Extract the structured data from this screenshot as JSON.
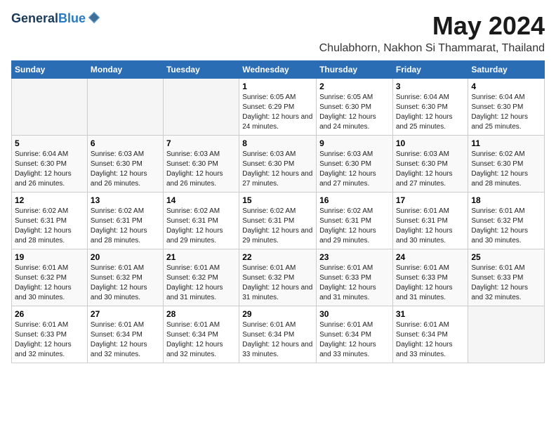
{
  "logo": {
    "general": "General",
    "blue": "Blue"
  },
  "title": {
    "month_year": "May 2024",
    "location": "Chulabhorn, Nakhon Si Thammarat, Thailand"
  },
  "weekdays": [
    "Sunday",
    "Monday",
    "Tuesday",
    "Wednesday",
    "Thursday",
    "Friday",
    "Saturday"
  ],
  "weeks": [
    [
      {
        "day": "",
        "info": ""
      },
      {
        "day": "",
        "info": ""
      },
      {
        "day": "",
        "info": ""
      },
      {
        "day": "1",
        "info": "Sunrise: 6:05 AM\nSunset: 6:29 PM\nDaylight: 12 hours and 24 minutes."
      },
      {
        "day": "2",
        "info": "Sunrise: 6:05 AM\nSunset: 6:30 PM\nDaylight: 12 hours and 24 minutes."
      },
      {
        "day": "3",
        "info": "Sunrise: 6:04 AM\nSunset: 6:30 PM\nDaylight: 12 hours and 25 minutes."
      },
      {
        "day": "4",
        "info": "Sunrise: 6:04 AM\nSunset: 6:30 PM\nDaylight: 12 hours and 25 minutes."
      }
    ],
    [
      {
        "day": "5",
        "info": "Sunrise: 6:04 AM\nSunset: 6:30 PM\nDaylight: 12 hours and 26 minutes."
      },
      {
        "day": "6",
        "info": "Sunrise: 6:03 AM\nSunset: 6:30 PM\nDaylight: 12 hours and 26 minutes."
      },
      {
        "day": "7",
        "info": "Sunrise: 6:03 AM\nSunset: 6:30 PM\nDaylight: 12 hours and 26 minutes."
      },
      {
        "day": "8",
        "info": "Sunrise: 6:03 AM\nSunset: 6:30 PM\nDaylight: 12 hours and 27 minutes."
      },
      {
        "day": "9",
        "info": "Sunrise: 6:03 AM\nSunset: 6:30 PM\nDaylight: 12 hours and 27 minutes."
      },
      {
        "day": "10",
        "info": "Sunrise: 6:03 AM\nSunset: 6:30 PM\nDaylight: 12 hours and 27 minutes."
      },
      {
        "day": "11",
        "info": "Sunrise: 6:02 AM\nSunset: 6:30 PM\nDaylight: 12 hours and 28 minutes."
      }
    ],
    [
      {
        "day": "12",
        "info": "Sunrise: 6:02 AM\nSunset: 6:31 PM\nDaylight: 12 hours and 28 minutes."
      },
      {
        "day": "13",
        "info": "Sunrise: 6:02 AM\nSunset: 6:31 PM\nDaylight: 12 hours and 28 minutes."
      },
      {
        "day": "14",
        "info": "Sunrise: 6:02 AM\nSunset: 6:31 PM\nDaylight: 12 hours and 29 minutes."
      },
      {
        "day": "15",
        "info": "Sunrise: 6:02 AM\nSunset: 6:31 PM\nDaylight: 12 hours and 29 minutes."
      },
      {
        "day": "16",
        "info": "Sunrise: 6:02 AM\nSunset: 6:31 PM\nDaylight: 12 hours and 29 minutes."
      },
      {
        "day": "17",
        "info": "Sunrise: 6:01 AM\nSunset: 6:31 PM\nDaylight: 12 hours and 30 minutes."
      },
      {
        "day": "18",
        "info": "Sunrise: 6:01 AM\nSunset: 6:32 PM\nDaylight: 12 hours and 30 minutes."
      }
    ],
    [
      {
        "day": "19",
        "info": "Sunrise: 6:01 AM\nSunset: 6:32 PM\nDaylight: 12 hours and 30 minutes."
      },
      {
        "day": "20",
        "info": "Sunrise: 6:01 AM\nSunset: 6:32 PM\nDaylight: 12 hours and 30 minutes."
      },
      {
        "day": "21",
        "info": "Sunrise: 6:01 AM\nSunset: 6:32 PM\nDaylight: 12 hours and 31 minutes."
      },
      {
        "day": "22",
        "info": "Sunrise: 6:01 AM\nSunset: 6:32 PM\nDaylight: 12 hours and 31 minutes."
      },
      {
        "day": "23",
        "info": "Sunrise: 6:01 AM\nSunset: 6:33 PM\nDaylight: 12 hours and 31 minutes."
      },
      {
        "day": "24",
        "info": "Sunrise: 6:01 AM\nSunset: 6:33 PM\nDaylight: 12 hours and 31 minutes."
      },
      {
        "day": "25",
        "info": "Sunrise: 6:01 AM\nSunset: 6:33 PM\nDaylight: 12 hours and 32 minutes."
      }
    ],
    [
      {
        "day": "26",
        "info": "Sunrise: 6:01 AM\nSunset: 6:33 PM\nDaylight: 12 hours and 32 minutes."
      },
      {
        "day": "27",
        "info": "Sunrise: 6:01 AM\nSunset: 6:34 PM\nDaylight: 12 hours and 32 minutes."
      },
      {
        "day": "28",
        "info": "Sunrise: 6:01 AM\nSunset: 6:34 PM\nDaylight: 12 hours and 32 minutes."
      },
      {
        "day": "29",
        "info": "Sunrise: 6:01 AM\nSunset: 6:34 PM\nDaylight: 12 hours and 33 minutes."
      },
      {
        "day": "30",
        "info": "Sunrise: 6:01 AM\nSunset: 6:34 PM\nDaylight: 12 hours and 33 minutes."
      },
      {
        "day": "31",
        "info": "Sunrise: 6:01 AM\nSunset: 6:34 PM\nDaylight: 12 hours and 33 minutes."
      },
      {
        "day": "",
        "info": ""
      }
    ]
  ]
}
